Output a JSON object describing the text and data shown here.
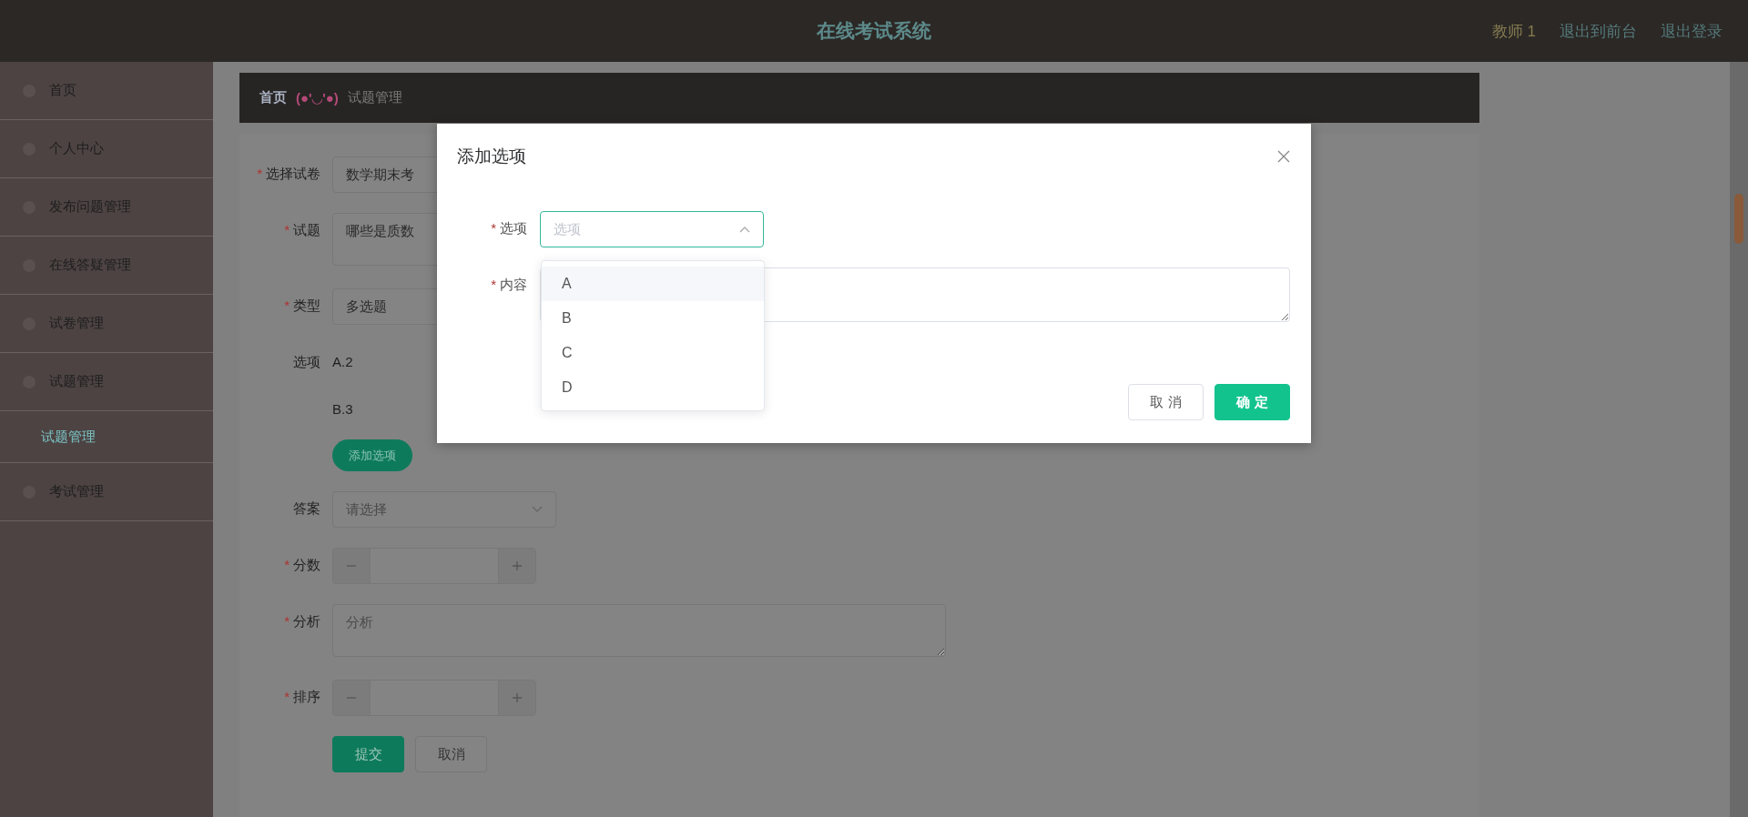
{
  "header": {
    "title": "在线考试系统",
    "user": "教师 1",
    "links": [
      "退出到前台",
      "退出登录"
    ]
  },
  "sidebar": {
    "items": [
      {
        "label": "首页"
      },
      {
        "label": "个人中心"
      },
      {
        "label": "发布问题管理"
      },
      {
        "label": "在线答疑管理"
      },
      {
        "label": "试卷管理"
      },
      {
        "label": "试题管理",
        "children": [
          {
            "label": "试题管理",
            "selected": true
          }
        ]
      },
      {
        "label": "考试管理"
      }
    ]
  },
  "breadcrumb": {
    "home": "首页",
    "emoticon": "(●'◡'●)",
    "current": "试题管理"
  },
  "form": {
    "fields": [
      {
        "kind": "select",
        "label": "选择试卷",
        "required_mark": "*",
        "value": "数学期末考"
      },
      {
        "kind": "textarea",
        "label": "试题",
        "required_mark": "*",
        "value": "哪些是质数"
      },
      {
        "kind": "select",
        "label": "类型",
        "required_mark": "*",
        "value": "多选题"
      },
      {
        "kind": "options",
        "label": "选项",
        "options": [
          "A.2",
          "B.3"
        ],
        "button": "添加选项"
      },
      {
        "kind": "select",
        "label": "答案",
        "placeholder": "请选择"
      },
      {
        "kind": "number",
        "label": "分数",
        "required_mark": "*"
      },
      {
        "kind": "textarea",
        "label": "分析",
        "required_mark": "*",
        "placeholder": "分析"
      },
      {
        "kind": "number",
        "label": "排序",
        "required_mark": "*"
      }
    ],
    "actions": [
      {
        "label": "提交",
        "kind": "primary"
      },
      {
        "label": "取消",
        "kind": "default"
      }
    ]
  },
  "modal": {
    "title": "添加选项",
    "select": {
      "label": "选项",
      "required_mark": "*",
      "placeholder": "选项",
      "open": true
    },
    "dropdown": [
      {
        "label": "A",
        "hovered": true
      },
      {
        "label": "B",
        "hovered": false
      },
      {
        "label": "C",
        "hovered": false
      },
      {
        "label": "D",
        "hovered": false
      }
    ],
    "content": {
      "label": "内容",
      "required_mark": "*"
    },
    "buttons": [
      {
        "label": "取 消",
        "kind": "default"
      },
      {
        "label": "确 定",
        "kind": "primary"
      }
    ]
  }
}
